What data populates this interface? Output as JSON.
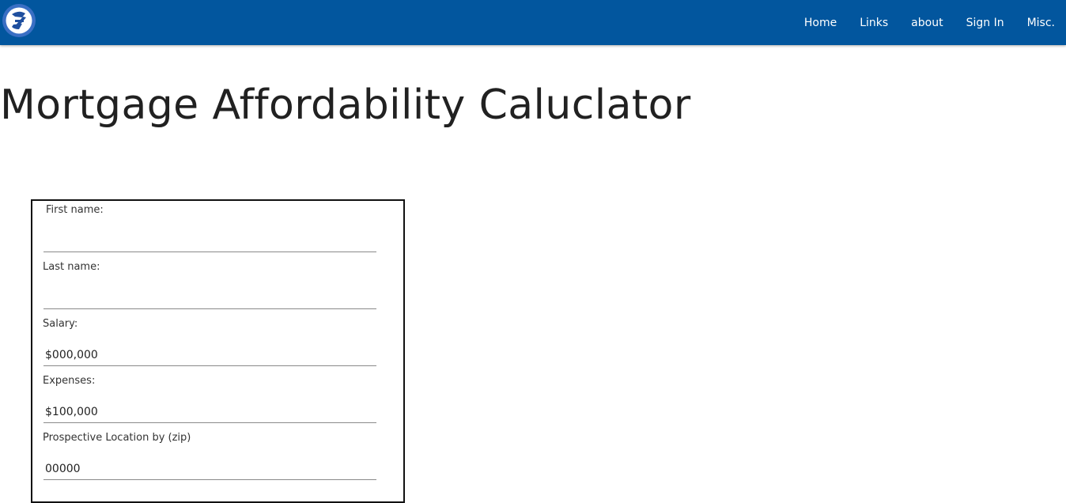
{
  "brand": {
    "logo_icon": "circular-logo-icon",
    "color": "#02569e"
  },
  "nav": {
    "items": [
      {
        "label": "Home"
      },
      {
        "label": "Links"
      },
      {
        "label": "about"
      },
      {
        "label": "Sign In"
      },
      {
        "label": "Misc."
      }
    ]
  },
  "page": {
    "title": "Mortgage Affordability Caluclator"
  },
  "form": {
    "first_name": {
      "label": "First name:",
      "value": ""
    },
    "last_name": {
      "label": "Last name:",
      "value": ""
    },
    "salary": {
      "label": "Salary:",
      "value": "$000,000"
    },
    "expenses": {
      "label": "Expenses:",
      "value": "$100,000"
    },
    "location": {
      "label": "Prospective Location by (zip)",
      "value": "00000"
    }
  }
}
